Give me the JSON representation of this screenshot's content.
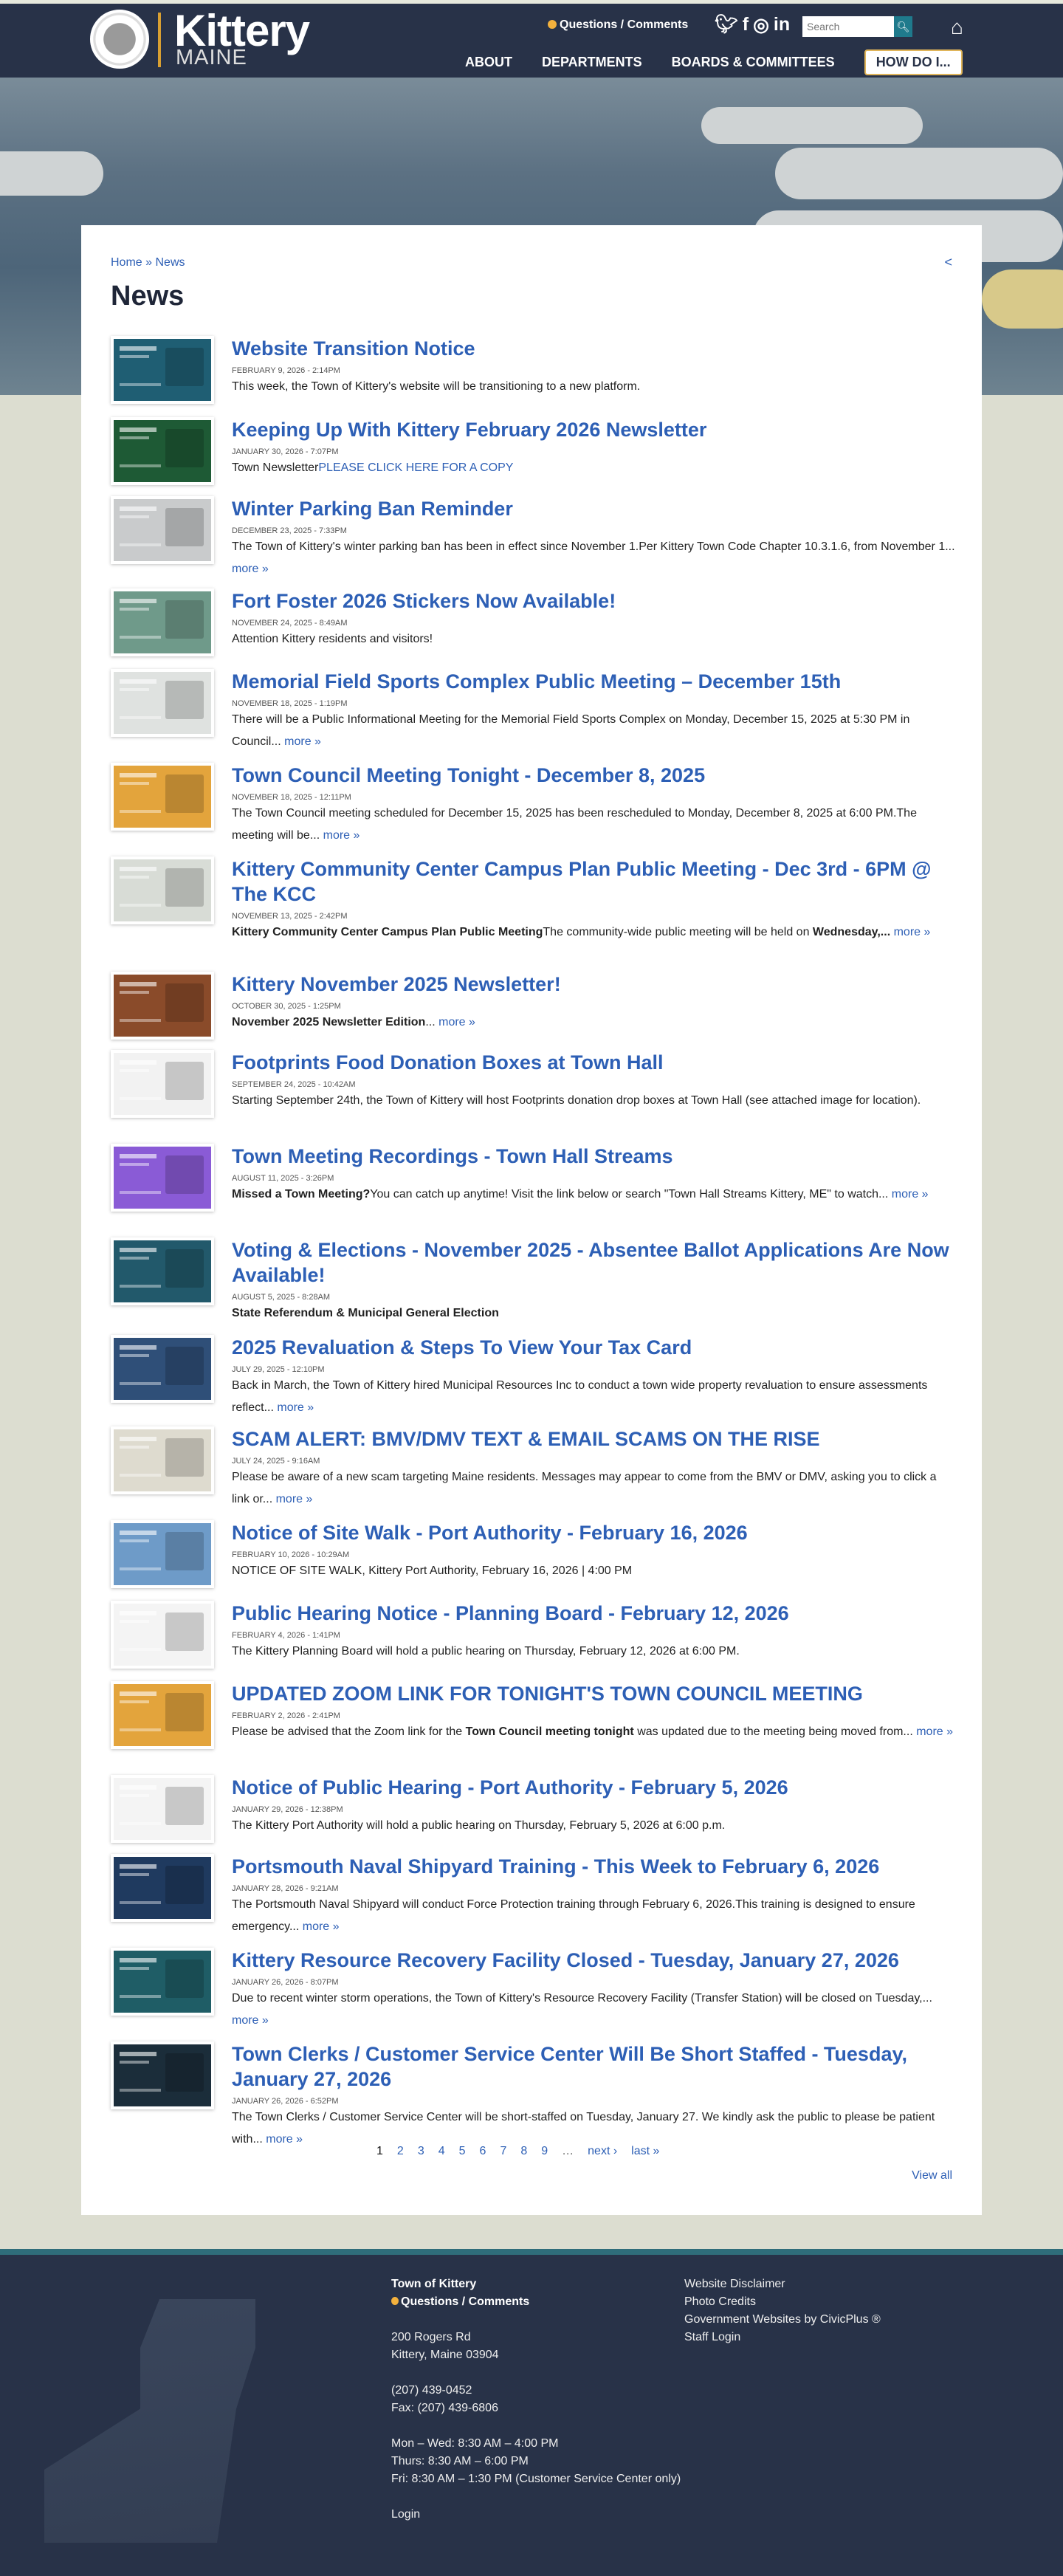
{
  "header": {
    "logo_main": "Kittery",
    "logo_sub": "MAINE",
    "questions": "Questions / Comments",
    "social": [
      "twitter",
      "facebook",
      "instagram",
      "linkedin"
    ],
    "search_placeholder": "Search",
    "nav": [
      "ABOUT",
      "DEPARTMENTS",
      "BOARDS & COMMITTEES"
    ],
    "how_do_i": "HOW DO I..."
  },
  "breadcrumb": {
    "home": "Home",
    "sep": "»",
    "current": "News"
  },
  "page_title": "News",
  "articles": [
    {
      "title": "Website Transition Notice",
      "date": "February 9, 2026 - 2:14PM",
      "body": [
        {
          "t": "This week, the Town of Kittery's website will be transitioning to a new platform."
        }
      ],
      "color": "#1f5e73"
    },
    {
      "title": "Keeping Up With Kittery February 2026 Newsletter",
      "date": "January 30, 2026 - 7:07PM",
      "body": [
        {
          "t": "Town Newsletter"
        },
        {
          "t": "PLEASE CLICK HERE FOR A COPY",
          "a": true
        }
      ],
      "color": "#1e5a35"
    },
    {
      "title": "Winter Parking Ban Reminder",
      "date": "December 23, 2025 - 7:33PM",
      "body": [
        {
          "t": "The Town of Kittery's winter parking ban has been in effect since November 1.Per Kittery Town Code Chapter 10.3.1.6, from November 1..."
        }
      ],
      "more": true,
      "color": "#c9cbcc"
    },
    {
      "title": "Fort Foster 2026 Stickers Now Available!",
      "date": "November 24, 2025 - 8:49AM",
      "body": [
        {
          "t": "Attention Kittery residents and visitors!"
        }
      ],
      "color": "#6f9a8a"
    },
    {
      "title": "Memorial Field Sports Complex Public Meeting – December 15th",
      "date": "November 18, 2025 - 1:19PM",
      "body": [
        {
          "t": "There will be a Public Informational Meeting for the Memorial Field Sports Complex on Monday, December 15, 2025 at 5:30 PM in Council..."
        }
      ],
      "more": true,
      "color": "#dfe2e0"
    },
    {
      "title": "Town Council Meeting Tonight - December 8, 2025",
      "date": "November 18, 2025 - 12:11PM",
      "body": [
        {
          "t": "The Town Council meeting scheduled for December 15, 2025 has been rescheduled to Monday, December 8, 2025 at 6:00 PM.The meeting will be..."
        }
      ],
      "more": true,
      "color": "#e3a43c"
    },
    {
      "title": "Kittery Community Center Campus Plan Public Meeting - Dec 3rd - 6PM @ The KCC",
      "date": "November 13, 2025 - 2:42PM",
      "body": [
        {
          "t": "Kittery Community Center Campus Plan Public Meeting",
          "b": true
        },
        {
          "t": "The community-wide public meeting will be held on "
        },
        {
          "t": "Wednesday,...",
          "b": true
        }
      ],
      "more": true,
      "color": "#d8dcd6"
    },
    {
      "title": "Kittery November 2025 Newsletter!",
      "date": "October 30, 2025 - 1:25PM",
      "body": [
        {
          "t": "November 2025 Newsletter Edition",
          "b": true
        },
        {
          "t": "..."
        }
      ],
      "more": true,
      "color": "#8a4b2a"
    },
    {
      "title": "Footprints Food Donation Boxes at Town Hall",
      "date": "September 24, 2025 - 10:42AM",
      "body": [
        {
          "t": "Starting September 24th, the Town of Kittery will host Footprints donation drop boxes at Town Hall (see attached image for location)."
        }
      ],
      "color": "#f2f2f2"
    },
    {
      "title": "Town Meeting Recordings - Town Hall Streams",
      "date": "August 11, 2025 - 3:26PM",
      "body": [
        {
          "t": "Missed a Town Meeting?",
          "b": true
        },
        {
          "t": "You can catch up anytime! Visit the link below or search \"Town Hall Streams Kittery, ME\" to watch..."
        }
      ],
      "more": true,
      "color": "#8a5bd6"
    },
    {
      "title": "Voting & Elections - November 2025 - Absentee Ballot Applications Are Now Available!",
      "date": "August 5, 2025 - 8:28AM",
      "body": [
        {
          "t": "State Referendum & Municipal General Election",
          "b": true
        }
      ],
      "color": "#22596b"
    },
    {
      "title": "2025 Revaluation & Steps To View Your Tax Card",
      "date": "July 29, 2025 - 12:10PM",
      "body": [
        {
          "t": "Back in March, the Town of Kittery hired Municipal Resources Inc to conduct a town wide property revaluation to ensure assessments reflect..."
        }
      ],
      "more": true,
      "color": "#2f4f78"
    },
    {
      "title": "SCAM ALERT: BMV/DMV TEXT & EMAIL SCAMS ON THE RISE",
      "date": "July 24, 2025 - 9:16AM",
      "body": [
        {
          "t": "Please be aware of a new scam targeting Maine residents. Messages may appear to come from the BMV or DMV, asking you to click a link or..."
        }
      ],
      "more": true,
      "color": "#dedbcf"
    },
    {
      "title": "Notice of Site Walk - Port Authority - February 16, 2026",
      "date": "February 10, 2026 - 10:29AM",
      "body": [
        {
          "t": "NOTICE OF SITE WALK, Kittery Port Authority, February 16, 2026 | 4:00 PM"
        }
      ],
      "color": "#6e9bc8"
    },
    {
      "title": "Public Hearing Notice - Planning Board - February 12, 2026",
      "date": "February 4, 2026 - 1:41PM",
      "body": [
        {
          "t": "The Kittery Planning Board will hold a public hearing on Thursday, February 12, 2026 at 6:00 PM."
        }
      ],
      "color": "#f4f4f4"
    },
    {
      "title": "UPDATED ZOOM LINK FOR TONIGHT'S TOWN COUNCIL MEETING",
      "date": "February 2, 2026 - 2:41PM",
      "body": [
        {
          "t": "Please be advised that the Zoom link for the "
        },
        {
          "t": "Town Council meeting tonight",
          "b": true
        },
        {
          "t": " was updated due to the meeting being moved from..."
        }
      ],
      "more": true,
      "color": "#e3a43c"
    },
    {
      "title": "Notice of Public Hearing - Port Authority - February 5, 2026",
      "date": "January 29, 2026 - 12:38PM",
      "body": [
        {
          "t": "The Kittery Port Authority will hold a public hearing on Thursday, February 5, 2026 at 6:00 p.m."
        }
      ],
      "color": "#f4f4f4"
    },
    {
      "title": "Portsmouth Naval Shipyard Training - This Week to February 6, 2026",
      "date": "January 28, 2026 - 9:21AM",
      "body": [
        {
          "t": "The Portsmouth Naval Shipyard will conduct Force Protection training through February 6, 2026.This training is designed to ensure emergency..."
        }
      ],
      "more": true,
      "color": "#1f3a5f"
    },
    {
      "title": "Kittery Resource Recovery Facility Closed - Tuesday, January 27, 2026",
      "date": "January 26, 2026 - 8:07PM",
      "body": [
        {
          "t": "Due to recent winter storm operations, the Town of Kittery's Resource Recovery Facility (Transfer Station) will be closed on Tuesday,..."
        }
      ],
      "more": true,
      "color": "#1f5d66"
    },
    {
      "title": "Town Clerks / Customer Service Center Will Be Short Staffed - Tuesday, January 27, 2026",
      "date": "January 26, 2026 - 6:52PM",
      "body": [
        {
          "t": "The Town Clerks / Customer Service Center will be short-staffed on Tuesday, January 27. We kindly ask the public to please be patient with..."
        }
      ],
      "more": true,
      "color": "#1b2d3a"
    }
  ],
  "more_label": "more »",
  "pagination": {
    "pages": [
      "1",
      "2",
      "3",
      "4",
      "5",
      "6",
      "7",
      "8",
      "9"
    ],
    "ellipsis": "…",
    "next": "next ›",
    "last": "last »",
    "current": "1"
  },
  "view_all": "View all",
  "footer": {
    "org": "Town of Kittery",
    "questions": "Questions / Comments",
    "address1": "200 Rogers Rd",
    "address2": "Kittery, Maine 03904",
    "phone": "(207) 439-0452",
    "fax": "Fax: (207) 439-6806",
    "hours1": "Mon – Wed: 8:30 AM – 4:00 PM",
    "hours2": "Thurs: 8:30 AM – 6:00 PM",
    "hours3": "Fri: 8:30 AM – 1:30 PM (Customer Service Center only)",
    "login": "Login",
    "links": [
      "Website Disclaimer",
      "Photo Credits",
      "Government Websites by CivicPlus ®",
      "Staff Login"
    ]
  },
  "colors": {
    "header": "#283248",
    "link": "#2d5fb5",
    "accent": "#d9a032"
  }
}
